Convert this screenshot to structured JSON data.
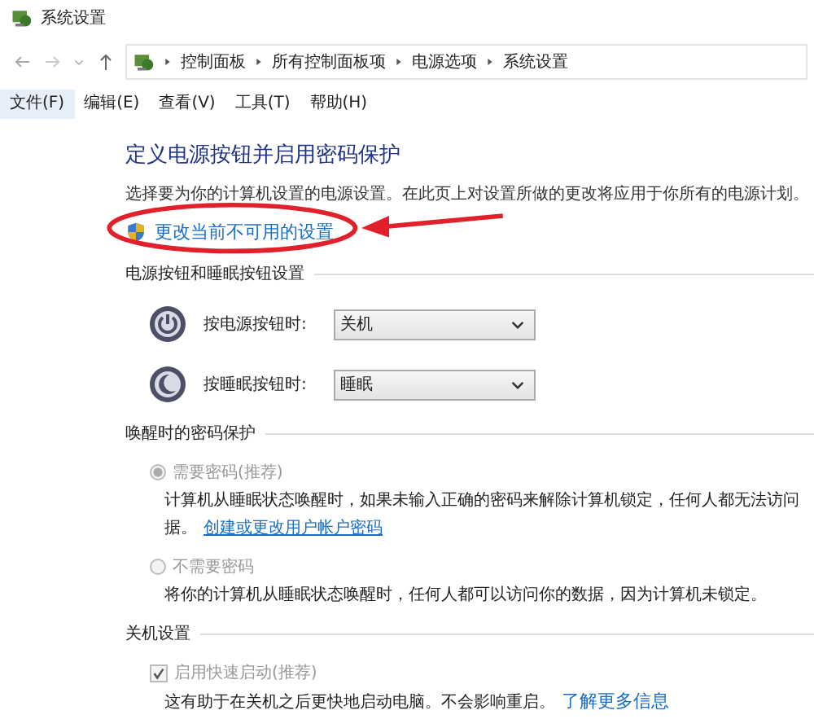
{
  "window": {
    "title": "系统设置"
  },
  "address_bar": {
    "path": [
      "控制面板",
      "所有控制面板项",
      "电源选项",
      "系统设置"
    ]
  },
  "menu": [
    {
      "label": "文件(F)",
      "selected": true
    },
    {
      "label": "编辑(E)",
      "selected": false
    },
    {
      "label": "查看(V)",
      "selected": false
    },
    {
      "label": "工具(T)",
      "selected": false
    },
    {
      "label": "帮助(H)",
      "selected": false
    }
  ],
  "heading": "定义电源按钮并启用密码保护",
  "description": "选择要为你的计算机设置的电源设置。在此页上对设置所做的更改将应用于你所有的电源计划。",
  "admin_link": "更改当前不可用的设置",
  "button_section": {
    "title": "电源按钮和睡眠按钮设置",
    "rows": [
      {
        "kind": "power",
        "label": "按电源按钮时:",
        "value": "关机"
      },
      {
        "kind": "sleep",
        "label": "按睡眠按钮时:",
        "value": "睡眠"
      }
    ]
  },
  "password_section": {
    "title": "唤醒时的密码保护",
    "options": [
      {
        "label": "需要密码(推荐)",
        "selected": true,
        "disabled": true,
        "lines": [
          "计算机从睡眠状态唤醒时，如果未输入正确的密码来解除计算机锁定，任何人都无法访问",
          "据。"
        ],
        "link": "创建或更改用户帐户密码"
      },
      {
        "label": "不需要密码",
        "selected": false,
        "disabled": true,
        "lines": [
          "将你的计算机从睡眠状态唤醒时，任何人都可以访问你的数据，因为计算机未锁定。"
        ]
      }
    ]
  },
  "shutdown_section": {
    "title": "关机设置",
    "options": [
      {
        "label": "启用快速启动(推荐)",
        "checked": true,
        "disabled": true,
        "note": "这有助于在关机之后更快地启动电脑。不会影响重启。",
        "link": "了解更多信息"
      }
    ]
  }
}
